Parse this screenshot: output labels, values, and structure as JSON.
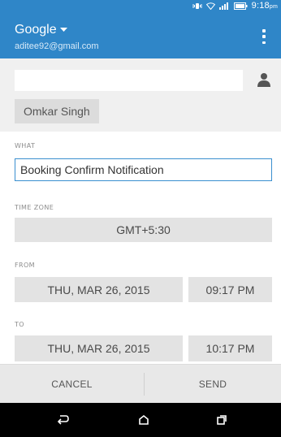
{
  "status_bar": {
    "time": "9:18",
    "ampm": "pm"
  },
  "account": {
    "name": "Google",
    "email": "aditee92@gmail.com"
  },
  "to": {
    "value": "",
    "placeholder": "",
    "recipient": "Omkar Singh"
  },
  "what": {
    "label": "WHAT",
    "value": "Booking Confirm Notification"
  },
  "timezone": {
    "label": "TIME ZONE",
    "value": "GMT+5:30"
  },
  "from": {
    "label": "FROM",
    "date": "THU, MAR 26, 2015",
    "time": "09:17 PM"
  },
  "to_time": {
    "label": "TO",
    "date": "THU, MAR 26, 2015",
    "time": "10:17 PM"
  },
  "actions": {
    "cancel": "CANCEL",
    "send": "SEND"
  },
  "colors": {
    "accent": "#2f86c8",
    "focus": "#3a8fcf"
  },
  "icons": {
    "status": [
      "vibrate-icon",
      "wifi-icon",
      "signal-icon",
      "battery-icon"
    ],
    "nav": [
      "back-icon",
      "home-icon",
      "recents-icon"
    ]
  }
}
